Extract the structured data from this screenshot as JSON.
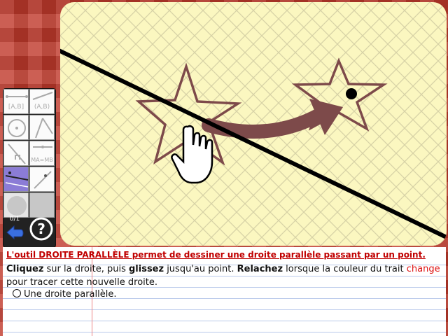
{
  "toolbar": {
    "counter": "0/1",
    "tools": [
      {
        "name": "segment",
        "label": "[A,B]"
      },
      {
        "name": "segment-alt",
        "label": "(A,B)"
      },
      {
        "name": "circle",
        "label": ""
      },
      {
        "name": "lines",
        "label": ""
      },
      {
        "name": "angle",
        "label": ""
      },
      {
        "name": "measure",
        "label": "MA=MB"
      },
      {
        "name": "parallel",
        "label": ""
      },
      {
        "name": "point",
        "label": ""
      },
      {
        "name": "fill-circle",
        "label": ""
      },
      {
        "name": "fill-square",
        "label": ""
      }
    ]
  },
  "canvas": {
    "background": "#fbf7c0",
    "grid_color": "#d7d2a6",
    "line_color": "#000000",
    "star_color": "#7d4a4a",
    "arrow_color": "#7d4a4a"
  },
  "instructions": {
    "title": "L'outil DROITE PARALLÈLE permet de dessiner une droite parallèle passant par un point.",
    "w_cliquez": "Cliquez",
    "t1": " sur la droite, puis ",
    "w_glissez": "glissez",
    "t2": " jusqu'au point. ",
    "w_relachez": "Relachez",
    "t3": " lorsque la couleur du trait ",
    "w_change": "change",
    "t4": " pour tracer cette nouvelle droite.",
    "goal": "Une droite parallèle."
  }
}
